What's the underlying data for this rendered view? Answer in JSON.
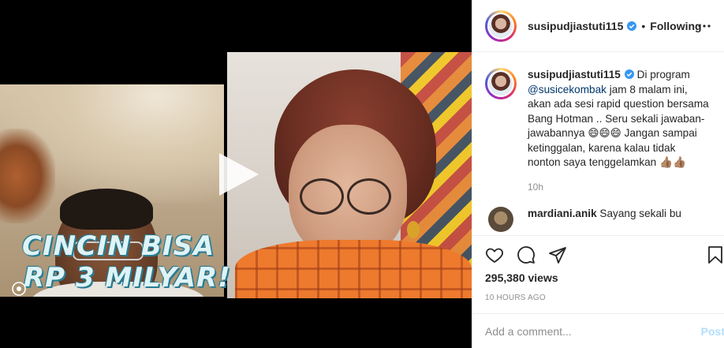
{
  "video": {
    "overlay_line1": "CINCIN BISA",
    "overlay_line2": "RP 3 MILYAR!"
  },
  "header": {
    "username": "susipudjiastuti115",
    "separator": "•",
    "follow_status": "Following"
  },
  "caption": {
    "username": "susipudjiastuti115",
    "text_before_mention": " Di program ",
    "mention": "@susicekombak",
    "text_after_mention": " jam 8 malam ini, akan ada sesi rapid question bersama Bang Hotman .. Seru sekali jawaban-jawabannya 😄😄😄 Jangan sampai ketinggalan, karena kalau tidak nonton saya tenggelamkan 👍🏽👍🏽",
    "time": "10h"
  },
  "comments": [
    {
      "username": "mardiani.anik",
      "text": "Sayang sekali bu"
    }
  ],
  "stats": {
    "views": "295,380 views",
    "posted": "10 HOURS AGO"
  },
  "comment_box": {
    "placeholder": "Add a comment...",
    "post_label": "Post"
  },
  "icons": {
    "like": "heart-icon",
    "comment": "comment-bubble-icon",
    "share": "paper-plane-icon",
    "save": "bookmark-icon",
    "more": "more-dots-icon",
    "verified": "verified-badge-icon",
    "play": "play-icon",
    "reel": "reel-icon"
  },
  "colors": {
    "verified": "#3897f0",
    "mention": "#00376b",
    "muted": "#8e8e8e",
    "post_disabled": "#b2dffc"
  }
}
